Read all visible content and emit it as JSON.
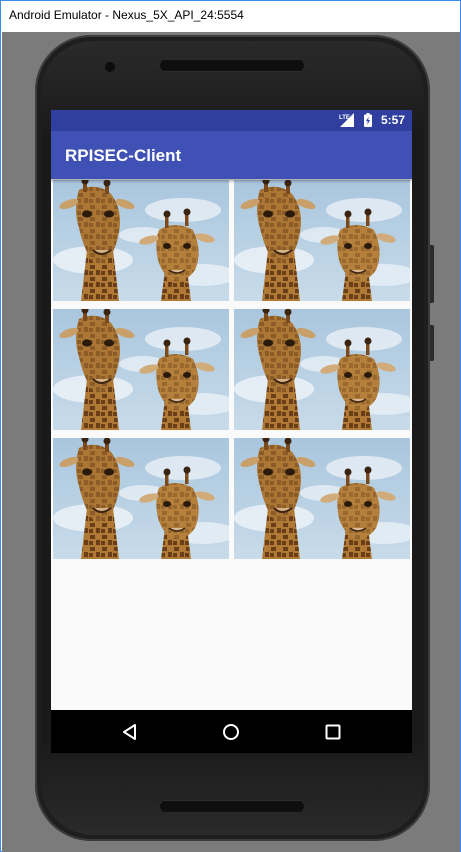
{
  "window": {
    "title": "Android Emulator - Nexus_5X_API_24:5554"
  },
  "status_bar": {
    "network_icon": "lte-signal-icon",
    "battery_icon": "battery-charging-icon",
    "time": "5:57",
    "color": "#303f9f"
  },
  "app_bar": {
    "title": "RPISEC-Client",
    "color": "#3f51b5"
  },
  "gallery": {
    "image_description_icon": "giraffe-photo",
    "tiles": [
      {
        "name": "giraffe-image-1"
      },
      {
        "name": "giraffe-image-2"
      },
      {
        "name": "giraffe-image-3"
      },
      {
        "name": "giraffe-image-4"
      },
      {
        "name": "giraffe-image-5"
      },
      {
        "name": "giraffe-image-6"
      }
    ]
  },
  "nav_bar": {
    "back_icon": "back-triangle-icon",
    "home_icon": "home-circle-icon",
    "recents_icon": "recents-square-icon"
  }
}
